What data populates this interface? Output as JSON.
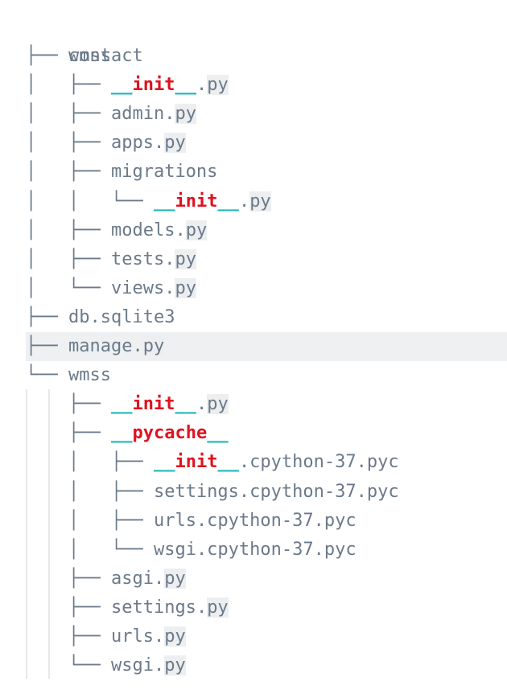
{
  "tree": {
    "root": "wmss",
    "lines": [
      {
        "prefix": "├── ",
        "name": "contact",
        "ext": "",
        "dunder": false
      },
      {
        "prefix": "│   ├── ",
        "name": "init",
        "ext": ".py",
        "dunder": true
      },
      {
        "prefix": "│   ├── ",
        "name": "admin",
        "ext": ".py",
        "dunder": false
      },
      {
        "prefix": "│   ├── ",
        "name": "apps",
        "ext": ".py",
        "dunder": false
      },
      {
        "prefix": "│   ├── ",
        "name": "migrations",
        "ext": "",
        "dunder": false
      },
      {
        "prefix": "│   │   └── ",
        "name": "init",
        "ext": ".py",
        "dunder": true
      },
      {
        "prefix": "│   ├── ",
        "name": "models",
        "ext": ".py",
        "dunder": false
      },
      {
        "prefix": "│   ├── ",
        "name": "tests",
        "ext": ".py",
        "dunder": false
      },
      {
        "prefix": "│   └── ",
        "name": "views",
        "ext": ".py",
        "dunder": false
      },
      {
        "prefix": "├── ",
        "name": "db.sqlite3",
        "ext": "",
        "dunder": false
      },
      {
        "prefix": "├── ",
        "name": "manage",
        "ext": ".py",
        "dunder": false,
        "selected": true
      },
      {
        "prefix": "└── ",
        "name": "wmss",
        "ext": "",
        "dunder": false
      },
      {
        "prefix": "    ├── ",
        "name": "init",
        "ext": ".py",
        "dunder": true
      },
      {
        "prefix": "    ├── ",
        "name": "pycache",
        "ext": "",
        "dunder": true
      },
      {
        "prefix": "    │   ├── ",
        "name": "init",
        "ext": ".cpython-37.pyc",
        "dunder": true
      },
      {
        "prefix": "    │   ├── ",
        "name": "settings",
        "ext": ".cpython-37.pyc",
        "dunder": false
      },
      {
        "prefix": "    │   ├── ",
        "name": "urls",
        "ext": ".cpython-37.pyc",
        "dunder": false
      },
      {
        "prefix": "    │   └── ",
        "name": "wsgi",
        "ext": ".cpython-37.pyc",
        "dunder": false
      },
      {
        "prefix": "    ├── ",
        "name": "asgi",
        "ext": ".py",
        "dunder": false
      },
      {
        "prefix": "    ├── ",
        "name": "settings",
        "ext": ".py",
        "dunder": false
      },
      {
        "prefix": "    ├── ",
        "name": "urls",
        "ext": ".py",
        "dunder": false
      },
      {
        "prefix": "    └── ",
        "name": "wsgi",
        "ext": ".py",
        "dunder": false
      }
    ]
  },
  "colors": {
    "text": "#6b7a8a",
    "dunder_underscore": "#1bb5b8",
    "dunder_name": "#e0121f",
    "ext_bg": "#eceeef",
    "selected_row_bg": "#eef0f2"
  }
}
